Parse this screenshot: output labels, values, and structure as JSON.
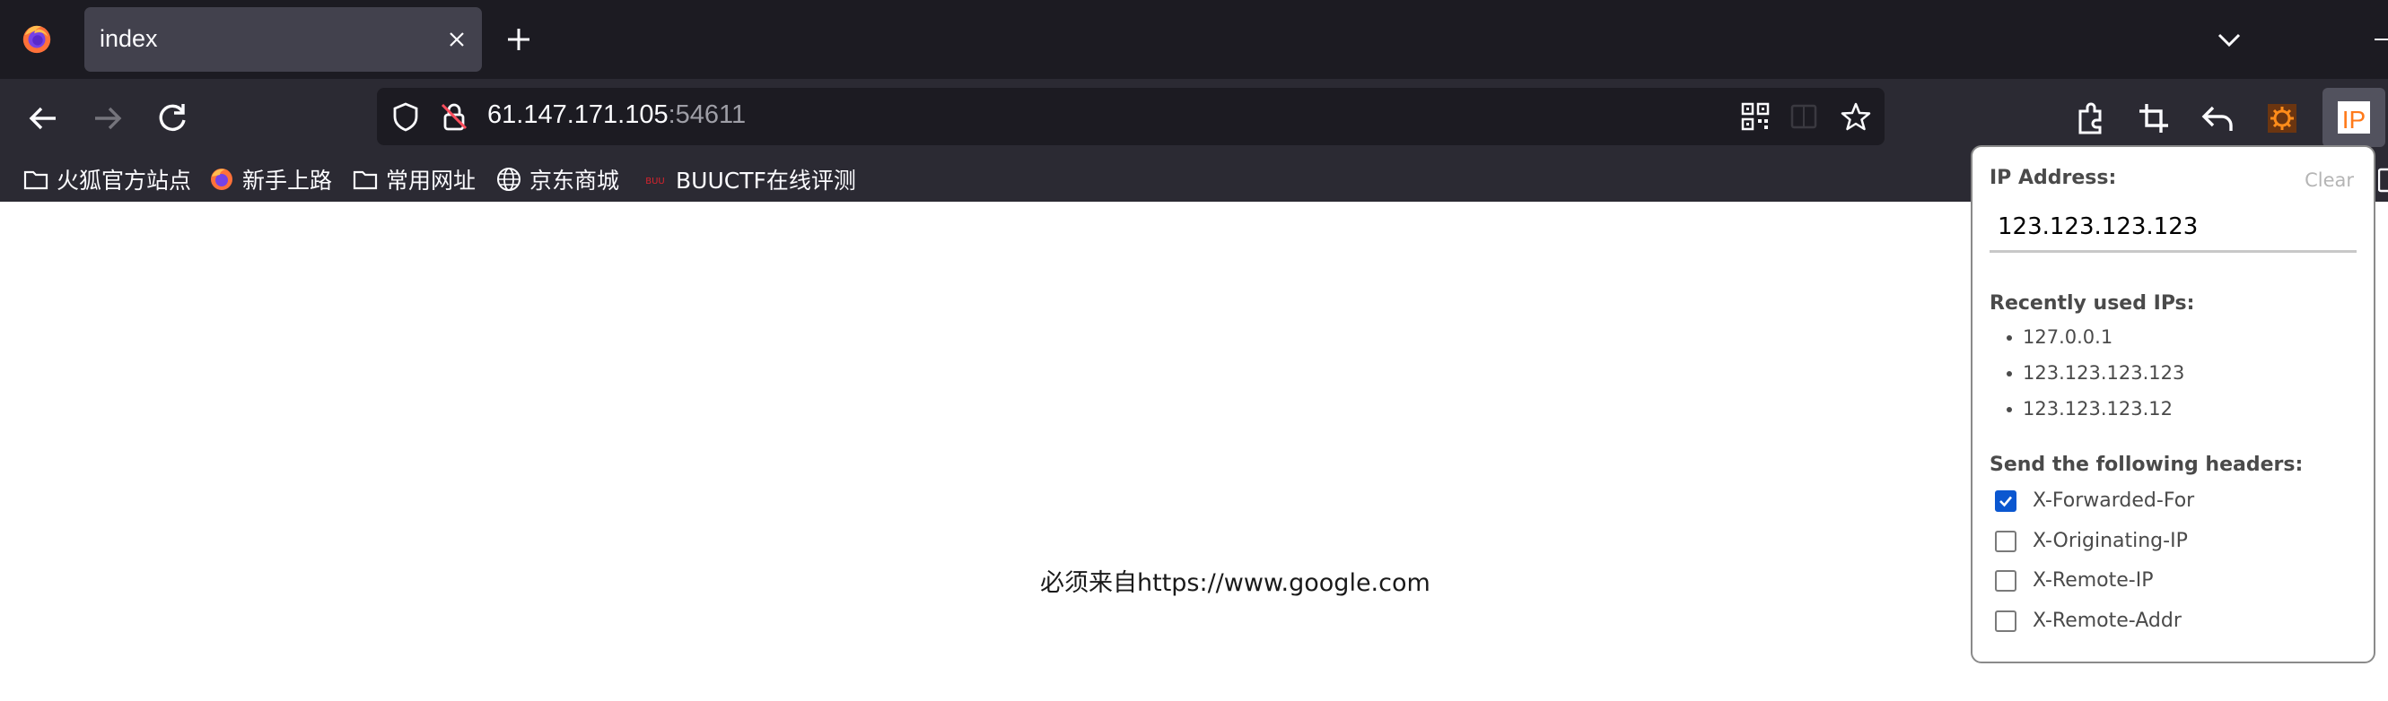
{
  "tab": {
    "title": "index"
  },
  "urlbar": {
    "host": "61.147.171.105",
    "port": ":54611"
  },
  "bookmarks": [
    {
      "label": "火狐官方站点",
      "icon": "folder-icon"
    },
    {
      "label": "新手上路",
      "icon": "firefox-icon"
    },
    {
      "label": "常用网址",
      "icon": "folder-icon"
    },
    {
      "label": "京东商城",
      "icon": "globe-icon"
    },
    {
      "label": "BUUCTF在线评测",
      "icon": "buuctf-favicon"
    }
  ],
  "page": {
    "message": "必须来自https://www.google.com"
  },
  "popup": {
    "ip_label": "IP Address:",
    "clear_label": "Clear",
    "ip_value": "123.123.123.123",
    "recent_label": "Recently used IPs:",
    "recent_ips": [
      "127.0.0.1",
      "123.123.123.123",
      "123.123.123.12"
    ],
    "headers_label": "Send the following headers:",
    "headers": [
      {
        "label": "X-Forwarded-For",
        "checked": true
      },
      {
        "label": "X-Originating-IP",
        "checked": false
      },
      {
        "label": "X-Remote-IP",
        "checked": false
      },
      {
        "label": "X-Remote-Addr",
        "checked": false
      }
    ]
  },
  "colors": {
    "accent": "#0b57d0",
    "chrome_dark": "#1c1b22",
    "toolbar": "#2b2a33",
    "ip_extension": "#ff7a1a"
  }
}
